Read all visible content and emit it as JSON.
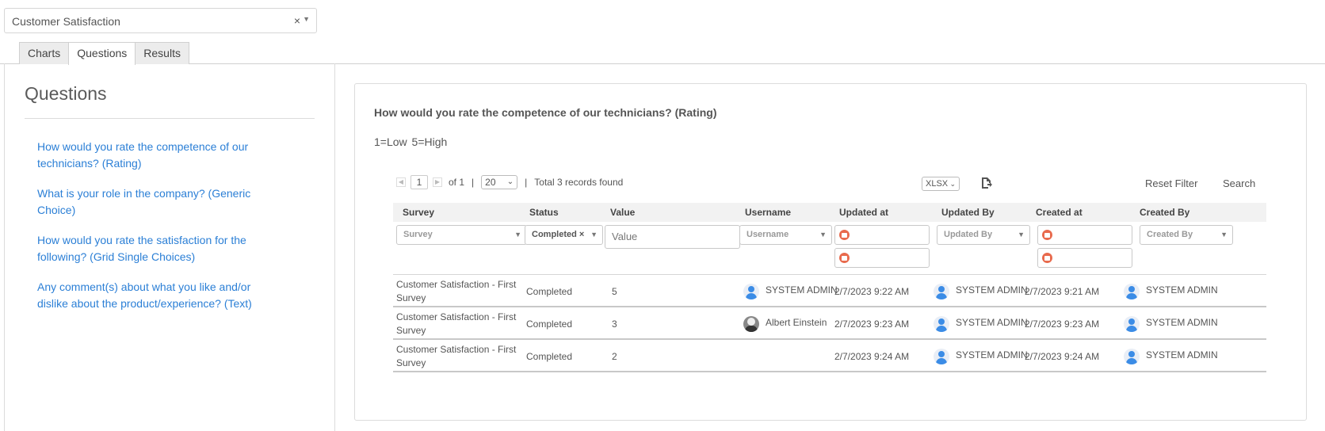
{
  "survey_select": {
    "value": "Customer Satisfaction",
    "clear_icon": "×"
  },
  "tabs": [
    {
      "label": "Charts",
      "active": false
    },
    {
      "label": "Questions",
      "active": true
    },
    {
      "label": "Results",
      "active": false
    }
  ],
  "left": {
    "title": "Questions",
    "questions": [
      "How would you rate the competence of our technicians? (Rating)",
      "What is your role in the company? (Generic Choice)",
      "How would you rate the satisfaction for the following? (Grid Single Choices)",
      "Any comment(s) about what you like and/or dislike about the product/experience? (Text)"
    ]
  },
  "detail": {
    "question_title": "How would you rate the competence of our technicians? (Rating)",
    "legend": "1=Low 5=High"
  },
  "toolbar": {
    "page": "1",
    "of_label": "of 1",
    "sep": "|",
    "page_size": "20",
    "total": "Total 3 records found",
    "export_format": "XLSX",
    "reset_label": "Reset Filter",
    "search_label": "Search"
  },
  "grid": {
    "columns": [
      "Survey",
      "Status",
      "Value",
      "Username",
      "Updated at",
      "Updated By",
      "Created at",
      "Created By"
    ],
    "filters": {
      "survey": "Survey",
      "status": "Completed",
      "value": "Value",
      "username": "Username",
      "updated_by": "Updated By",
      "created_by": "Created By"
    },
    "rows": [
      {
        "survey": "Customer Satisfaction - First Survey",
        "status": "Completed",
        "value": "5",
        "username": "SYSTEM ADMIN",
        "user_avatar": "person-icon",
        "updated_at": "2/7/2023 9:22 AM",
        "updated_by": "SYSTEM ADMIN",
        "created_at": "2/7/2023 9:21 AM",
        "created_by": "SYSTEM ADMIN"
      },
      {
        "survey": "Customer Satisfaction - First Survey",
        "status": "Completed",
        "value": "3",
        "username": "Albert Einstein",
        "user_avatar": "photo-avatar",
        "updated_at": "2/7/2023 9:23 AM",
        "updated_by": "SYSTEM ADMIN",
        "created_at": "2/7/2023 9:23 AM",
        "created_by": "SYSTEM ADMIN"
      },
      {
        "survey": "Customer Satisfaction - First Survey",
        "status": "Completed",
        "value": "2",
        "username": "",
        "user_avatar": "",
        "updated_at": "2/7/2023 9:24 AM",
        "updated_by": "SYSTEM ADMIN",
        "created_at": "2/7/2023 9:24 AM",
        "created_by": "SYSTEM ADMIN"
      }
    ]
  }
}
